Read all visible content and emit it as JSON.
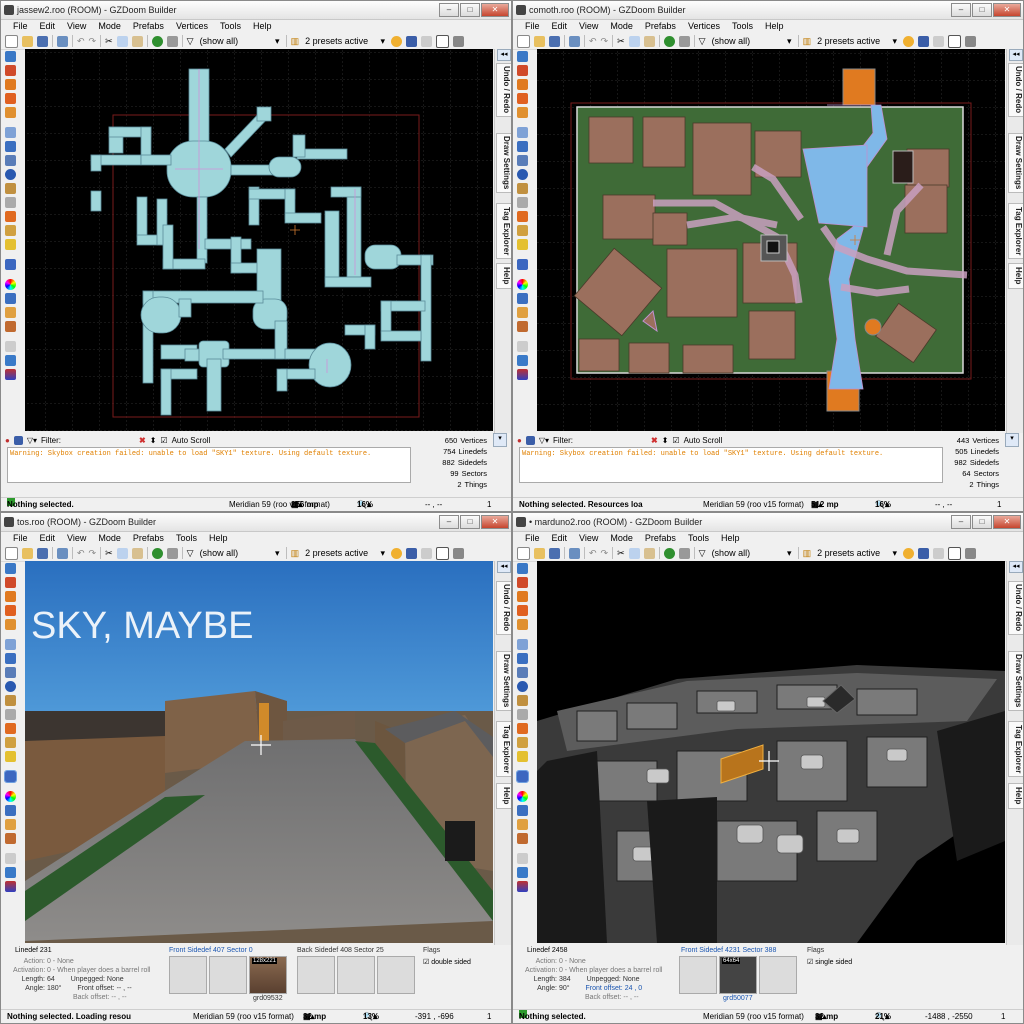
{
  "common": {
    "menu": [
      "File",
      "Edit",
      "View",
      "Mode",
      "Prefabs",
      "Vertices",
      "Tools",
      "Help"
    ],
    "menu_3d": [
      "File",
      "Edit",
      "View",
      "Mode",
      "Prefabs",
      "Tools",
      "Help"
    ],
    "filter_mode": "(show all)",
    "presets": "2 presets active",
    "filter_label": "Filter:",
    "autoscroll": "Auto Scroll",
    "tabs": [
      "Undo / Redo",
      "Draw Settings",
      "Tag Explorer",
      "Help"
    ],
    "warning": "Warning: Skybox creation failed: unable to load \"SKY1\" texture. Using default texture.",
    "format": "Meridian 59 (roo v15 format)",
    "colors": {
      "map_bg": "#000000",
      "grid": "#2a2a2a",
      "room_fill": "#9fd6da",
      "grass": "#3f6b37",
      "water": "#7fb8e8",
      "warning": "#e08000",
      "status_green": "#2c9a2c"
    }
  },
  "win1": {
    "title": "jassew2.roo (ROOM) - GZDoom Builder",
    "stats": [
      {
        "n": "650",
        "k": "Vertices"
      },
      {
        "n": "754",
        "k": "Linedefs"
      },
      {
        "n": "882",
        "k": "Sidedefs"
      },
      {
        "n": "99",
        "k": "Sectors"
      },
      {
        "n": "2",
        "k": "Things"
      }
    ],
    "status": "Nothing selected.",
    "grid": "256 mp",
    "zoom": "16%",
    "coords": "-- , --",
    "page": "1"
  },
  "win2": {
    "title": "comoth.roo (ROOM) - GZDoom Builder",
    "stats": [
      {
        "n": "443",
        "k": "Vertices"
      },
      {
        "n": "505",
        "k": "Linedefs"
      },
      {
        "n": "982",
        "k": "Sidedefs"
      },
      {
        "n": "64",
        "k": "Sectors"
      },
      {
        "n": "2",
        "k": "Things"
      }
    ],
    "status": "Nothing selected. Resources loa",
    "grid": "512 mp",
    "zoom": "16%",
    "coords": "-- , --",
    "page": "1"
  },
  "win3": {
    "title": "tos.roo (ROOM) - GZDoom Builder",
    "sky_text": "SKY, MAYBE",
    "linedef": "Linedef 231",
    "rows": [
      {
        "k": "Action:",
        "v": "0 - None"
      },
      {
        "k": "Activation:",
        "v": "0 - When player does a barrel roll"
      },
      {
        "k": "Length:",
        "v": "64"
      },
      {
        "k": "Angle:",
        "v": "180°"
      }
    ],
    "rows2": [
      {
        "k": "Unpegged:",
        "v": "None"
      },
      {
        "k": "Front offset:",
        "v": "-- , --"
      },
      {
        "k": "Back offset:",
        "v": "-- , --"
      }
    ],
    "front": "Front Sidedef 407  Sector 0",
    "back": "Back Sidedef 408  Sector 25",
    "tex_size": "128x221",
    "tex_name": "grd09532",
    "flags": "Flags",
    "flag1": "double sided",
    "status": "Nothing selected. Loading resou",
    "grid": "32 mp",
    "zoom": "13%",
    "coords": "-391 , -696",
    "page": "1"
  },
  "win4": {
    "title": "• marduno2.roo (ROOM) - GZDoom Builder",
    "linedef": "Linedef 2458",
    "rows": [
      {
        "k": "Action:",
        "v": "0 - None"
      },
      {
        "k": "Activation:",
        "v": "0 - When player does a barrel roll"
      },
      {
        "k": "Length:",
        "v": "384"
      },
      {
        "k": "Angle:",
        "v": "90°"
      }
    ],
    "rows2": [
      {
        "k": "Unpegged:",
        "v": "None"
      },
      {
        "k": "Front offset:",
        "v": "24 , 0"
      },
      {
        "k": "Back offset:",
        "v": "-- , --"
      }
    ],
    "front": "Front Sidedef 4231  Sector 388",
    "tex_size": "64x64",
    "tex_name": "grd50077",
    "flags": "Flags",
    "flag1": "single sided",
    "status": "Nothing selected.",
    "grid": "32 mp",
    "zoom": "21%",
    "coords": "-1488 , -2550",
    "page": "1"
  }
}
